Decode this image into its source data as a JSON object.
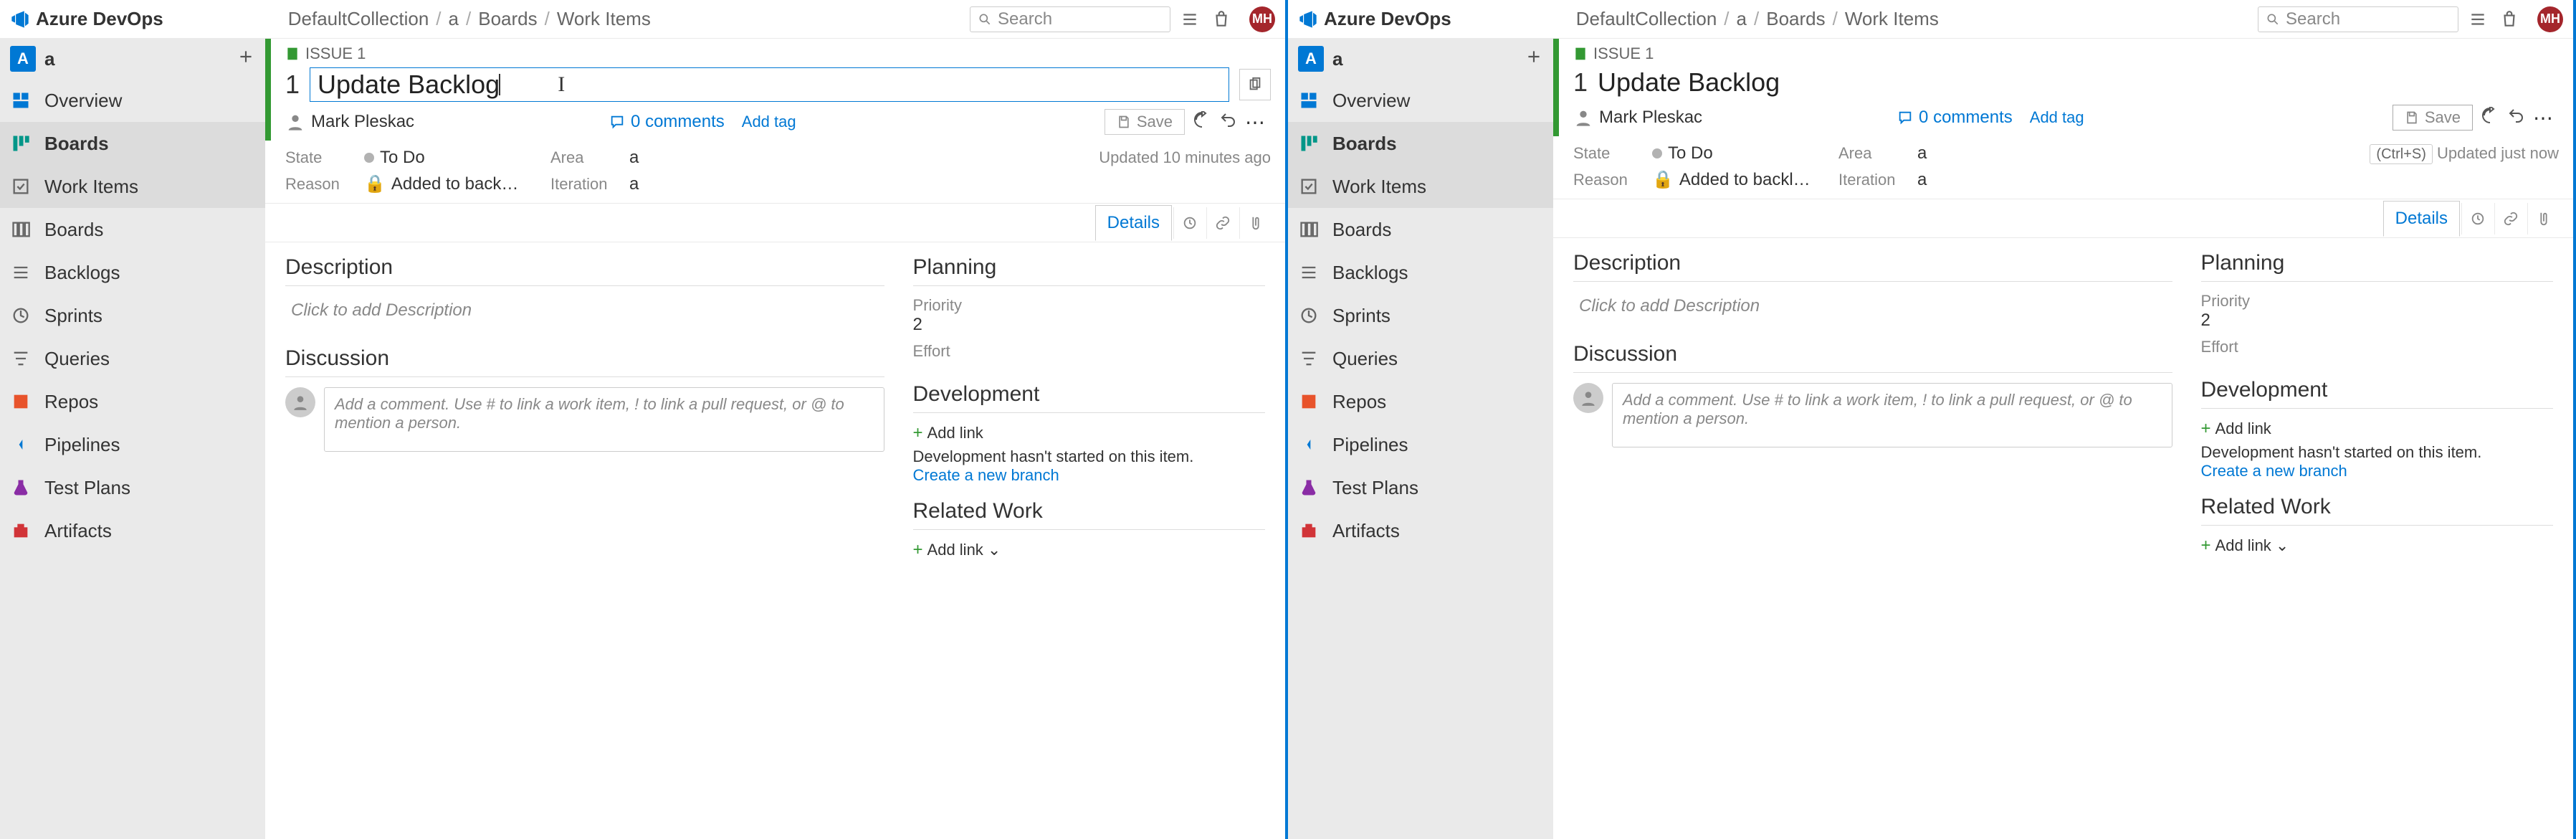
{
  "brand": "Azure DevOps",
  "breadcrumb": [
    "DefaultCollection",
    "a",
    "Boards",
    "Work Items"
  ],
  "search_placeholder": "Search",
  "avatar_initials": "MH",
  "project": {
    "initial": "A",
    "name": "a"
  },
  "nav": {
    "overview": "Overview",
    "boards": "Boards",
    "workitems": "Work Items",
    "boards_sub": "Boards",
    "backlogs": "Backlogs",
    "sprints": "Sprints",
    "queries": "Queries",
    "repos": "Repos",
    "pipelines": "Pipelines",
    "testplans": "Test Plans",
    "artifacts": "Artifacts"
  },
  "workitem": {
    "issue_label": "ISSUE 1",
    "number": "1",
    "title": "Update Backlog",
    "assigned": "Mark Pleskac",
    "comments": "0 comments",
    "add_tag": "Add tag",
    "save": "Save",
    "state_label": "State",
    "state_value": "To Do",
    "area_label": "Area",
    "area_value": "a",
    "reason_label": "Reason",
    "reason_value_left": "Added to back…",
    "reason_value_right": "Added to backl…",
    "iteration_label": "Iteration",
    "iteration_value": "a",
    "updated_left": "Updated 10 minutes ago",
    "updated_right": "Updated just now",
    "shortcut": "(Ctrl+S)"
  },
  "tabs": {
    "details": "Details"
  },
  "sections": {
    "description": "Description",
    "description_ph": "Click to add Description",
    "discussion": "Discussion",
    "discussion_ph": "Add a comment. Use # to link a work item, ! to link a pull request, or @ to mention a person.",
    "planning": "Planning",
    "priority_lbl": "Priority",
    "priority_val": "2",
    "effort_lbl": "Effort",
    "development": "Development",
    "add_link": "Add link",
    "dev_text": "Development hasn't started on this item.",
    "create_branch": "Create a new branch",
    "related": "Related Work",
    "add_link_dd": "Add link ⌄"
  }
}
